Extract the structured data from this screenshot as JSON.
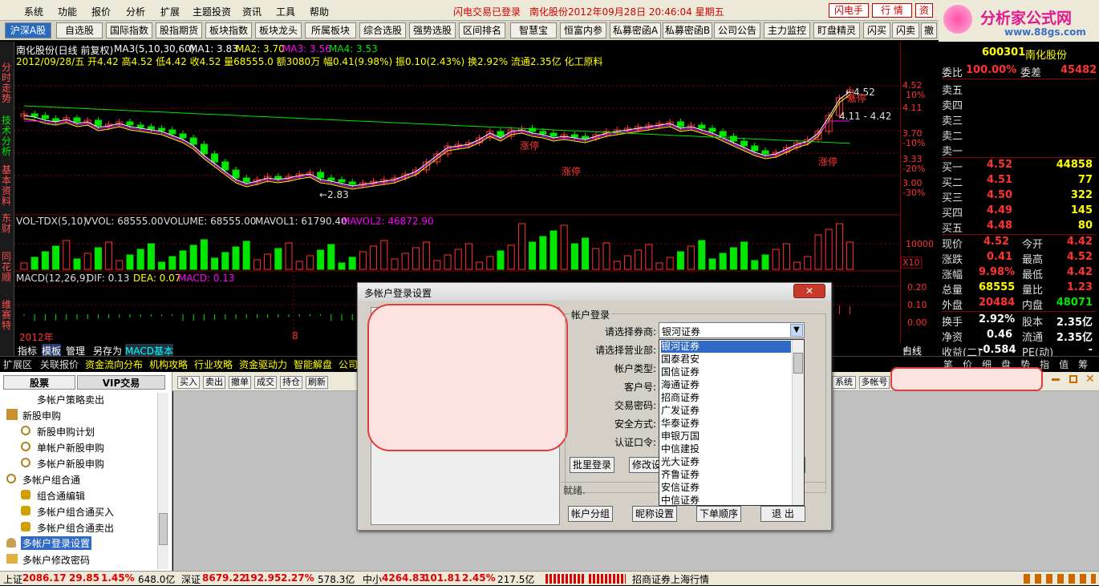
{
  "menubar": {
    "items": [
      "系统",
      "功能",
      "报价",
      "分析",
      "扩展",
      "主题投资",
      "资讯",
      "工具",
      "帮助"
    ],
    "status_login": "闪电交易已登录",
    "status_stock": "南化股份2012年09月28日  20:46:04 星期五",
    "btn_flash": "闪电手",
    "btn_quote": "行  情",
    "btn_trade": "资"
  },
  "logo": {
    "title": "分析家公式网",
    "url": "www.88gs.com"
  },
  "tabs": [
    "沪深A股",
    "自选股",
    "国际指数",
    "股指期货",
    "板块指数",
    "板块龙头",
    "所属板块",
    "综合选股",
    "强势选股",
    "区间排名",
    "智慧宝",
    "恒富内参",
    "私募密函A",
    "私募密函B",
    "公司公告",
    "主力监控",
    "盯盘精灵",
    "闪买",
    "闪卖",
    "撤"
  ],
  "lefttabs": [
    "分时走势",
    "技术分析",
    "基本资料",
    "东财",
    "同花顺",
    "维赛特"
  ],
  "chart": {
    "title": "南化股份(日线 前复权)",
    "ma_legend": "MA3(5,10,30,60)",
    "ma1": "MA1: 3.83",
    "ma2": "MA2: 3.70",
    "ma3": "MA3: 3.56",
    "ma4": "MA4: 3.53",
    "info_line": "2012/09/28/五 开4.42 高4.52 低4.42 收4.52 量68555.0 额3080万 幅0.41(9.98%) 振0.10(2.43%) 换2.92% 流通2.35亿 化工原料",
    "price_labels": [
      "4.52",
      "4.11",
      "3.70",
      "3.33",
      "3.00"
    ],
    "pct_labels": [
      "10%",
      "-10%",
      "-20%",
      "-30%"
    ],
    "low_marker": "←2.83",
    "high_marker": "←4.52",
    "range_marker": "4.11 - 4.42",
    "limit_up": "涨停",
    "vol_title": "VOL-TDX(5,10)",
    "vol_vvol": "VVOL: 68555.00",
    "vol_volume": "VOLUME: 68555.00",
    "vol_mavol1": "MAVOL1: 61790.40",
    "vol_mavol2": "MAVOL2: 46872.90",
    "vol_axis": "10000",
    "vol_unit": "X10",
    "macd_title": "MACD(12,26,9)",
    "macd_dif": "DIF: 0.13",
    "macd_dea": "DEA: 0.07",
    "macd_macd": "MACD: 0.13",
    "macd_axis": [
      "0.20",
      "0.10",
      "0.00"
    ],
    "year_label": "2012年",
    "month_label": "8",
    "zoom": "+ -"
  },
  "indbar": [
    "指标",
    "模板",
    "管理",
    "另存为",
    "MACD基本"
  ],
  "funcbar": [
    "扩展区",
    "关联报价",
    "资金流向分布",
    "机构攻略",
    "行业攻略",
    "资金驱动力",
    "智能解盘",
    "公司"
  ],
  "quote": {
    "code": "600301",
    "name": "南化股份",
    "webi_label": "委比",
    "webi": "100.00%",
    "wecha_label": "委差",
    "wecha": "45482",
    "asks": [
      "卖五",
      "卖四",
      "卖三",
      "卖二",
      "卖一"
    ],
    "bids": [
      {
        "label": "买一",
        "price": "4.52",
        "vol": "44858"
      },
      {
        "label": "买二",
        "price": "4.51",
        "vol": "77"
      },
      {
        "label": "买三",
        "price": "4.50",
        "vol": "322"
      },
      {
        "label": "买四",
        "price": "4.49",
        "vol": "145"
      },
      {
        "label": "买五",
        "price": "4.48",
        "vol": "80"
      }
    ],
    "stats": [
      {
        "l1": "现价",
        "v1": "4.52",
        "l2": "今开",
        "v2": "4.42"
      },
      {
        "l1": "涨跌",
        "v1": "0.41",
        "l2": "最高",
        "v2": "4.52"
      },
      {
        "l1": "涨幅",
        "v1": "9.98%",
        "l2": "最低",
        "v2": "4.42"
      },
      {
        "l1": "总量",
        "v1": "68555",
        "l2": "量比",
        "v2": "1.23"
      },
      {
        "l1": "外盘",
        "v1": "20484",
        "l2": "内盘",
        "v2": "48071"
      },
      {
        "l1": "换手",
        "v1": "2.92%",
        "l2": "股本",
        "v2": "2.35亿"
      },
      {
        "l1": "净资",
        "v1": "0.46",
        "l2": "流通",
        "v2": "2.35亿"
      },
      {
        "l1": "收益(二)",
        "v1": "-0.584",
        "l2": "PE(动)",
        "v2": "-"
      }
    ],
    "bottom_tabs": [
      "笔",
      "价",
      "细",
      "盘",
      "势",
      "指",
      "值",
      "筹"
    ],
    "side": "白线"
  },
  "sidebar": {
    "tab_stock": "股票",
    "tab_vip": "VIP交易",
    "items": [
      {
        "label": "多帐户策略卖出",
        "level": 2
      },
      {
        "label": "新股申购",
        "level": 1
      },
      {
        "label": "新股申购计划",
        "level": 2
      },
      {
        "label": "单帐户新股申购",
        "level": 2
      },
      {
        "label": "多帐户新股申购",
        "level": 2
      },
      {
        "label": "多帐户组合通",
        "level": 1
      },
      {
        "label": "组合通编辑",
        "level": 2
      },
      {
        "label": "多帐户组合通买入",
        "level": 2
      },
      {
        "label": "多帐户组合通卖出",
        "level": 2
      },
      {
        "label": "多帐户登录设置",
        "level": 1
      },
      {
        "label": "多帐户修改密码",
        "level": 1
      }
    ]
  },
  "toolstrip": {
    "buttons": [
      "买入",
      "卖出",
      "撤单",
      "成交",
      "持仓",
      "刷新"
    ],
    "right_buttons": [
      "系统",
      "多帐号"
    ]
  },
  "dialog": {
    "title": "多帐户登录设置",
    "group": "帐户登录",
    "labels": [
      "请选择券商:",
      "请选择营业部:",
      "帐户类型:",
      "客户号:",
      "交易密码:",
      "安全方式:",
      "认证口令:"
    ],
    "broker_value": "银河证券",
    "broker_options": [
      "银河证券",
      "国泰君安",
      "国信证券",
      "海通证券",
      "招商证券",
      "广发证券",
      "华泰证券",
      "申银万国",
      "中信建投",
      "光大证券",
      "齐鲁证券",
      "安信证券",
      "中信证券"
    ],
    "btn_batch": "批里登录",
    "btn_modify": "修改设",
    "status": "就绪.",
    "btn_group": "帐户分组",
    "btn_nick": "昵称设置",
    "btn_order": "下单顺序",
    "btn_exit": "退  出"
  },
  "statusbar": {
    "sh_label": "上证",
    "sh_val": "2086.17",
    "sh_chg": "29.85",
    "sh_pct": "1.45%",
    "sh_amt": "648.0亿",
    "sz_label": "深证",
    "sz_val": "8679.22",
    "sz_chg": "192.95",
    "sz_pct": "2.27%",
    "sz_amt": "578.3亿",
    "zx_label": "中小",
    "zx_val": "4264.83",
    "zx_chg": "101.81",
    "zx_pct": "2.45%",
    "zx_amt": "217.5亿",
    "feed": "招商证券上海行情"
  },
  "colors": {
    "up": "#ff3232",
    "down": "#00e600",
    "yellow": "#ffff00",
    "magenta": "#ff00ff",
    "cyan": "#00ffff"
  }
}
